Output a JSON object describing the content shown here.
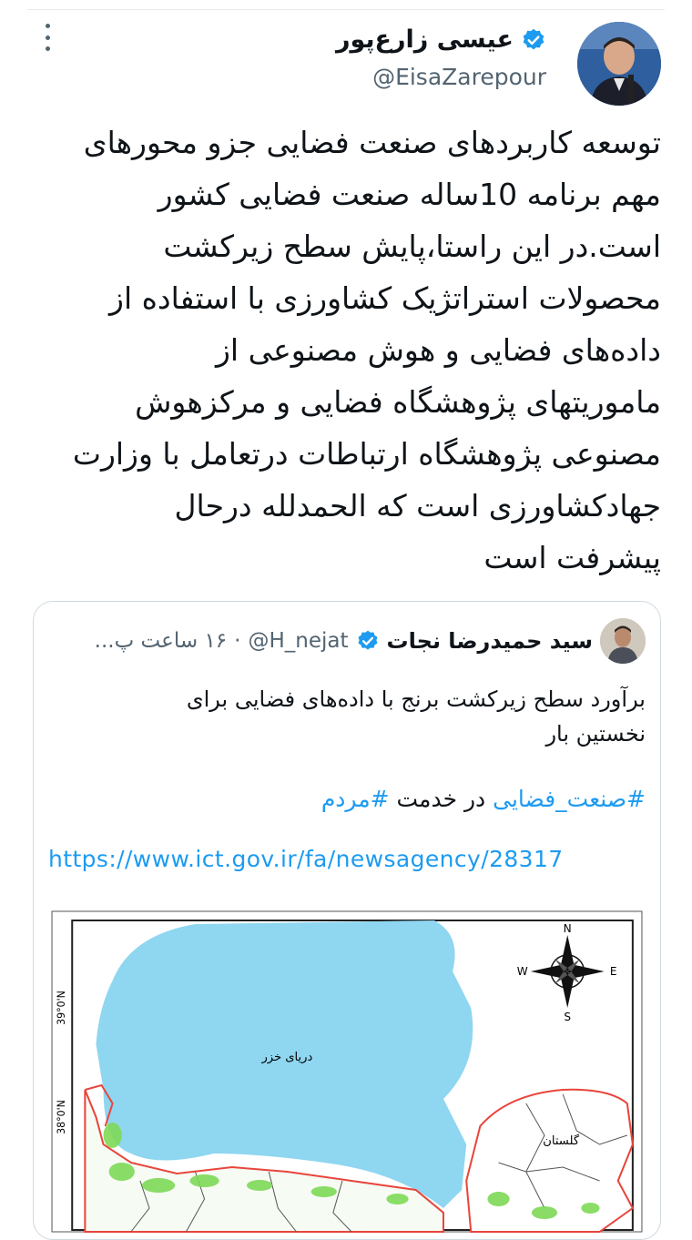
{
  "tweet": {
    "author_name": "عیسی زارع‌پور",
    "handle": "@EisaZarepour",
    "text": "توسعه کاربردهای صنعت فضایی جزو محورهای\nمهم برنامه 10ساله صنعت فضایی کشور\nاست.در این راستا،پایش سطح زیرکشت\nمحصولات استراتژیک کشاورزی با استفاده از\nداده‌های فضایی و هوش مصنوعی از\nماموریتهای پژوهشگاه فضایی و مرکزهوش\nمصنوعی پژوهشگاه ارتباطات درتعامل با وزارت\nجهادکشاورزی است که الحمدلله درحال\nپیشرفت است"
  },
  "quoted_tweet": {
    "author_name": "سید حمیدرضا نجات",
    "handle": "@H_nejat",
    "separator": "·",
    "time": "۱۶ ساعت پ...",
    "text": "برآورد سطح زیرکشت برنج با داده‌های فضایی برای\nنخستین بار",
    "hashtag_1": "#صنعت_فضایی",
    "middle_text": " در خدمت ",
    "hashtag_2": "#مردم",
    "link": "https://www.ict.gov.ir/fa/newsagency/28317"
  },
  "map": {
    "sea_label": "دریای خزر",
    "province_label": "گلستان",
    "lat_label_1": "39°0'N",
    "lat_label_2": "38°0'N",
    "compass_n": "N",
    "compass_s": "S",
    "compass_e": "E",
    "compass_w": "W",
    "colors": {
      "sea": "#8fd6f1",
      "border": "#e8453c",
      "rice": "#7ed957"
    }
  }
}
